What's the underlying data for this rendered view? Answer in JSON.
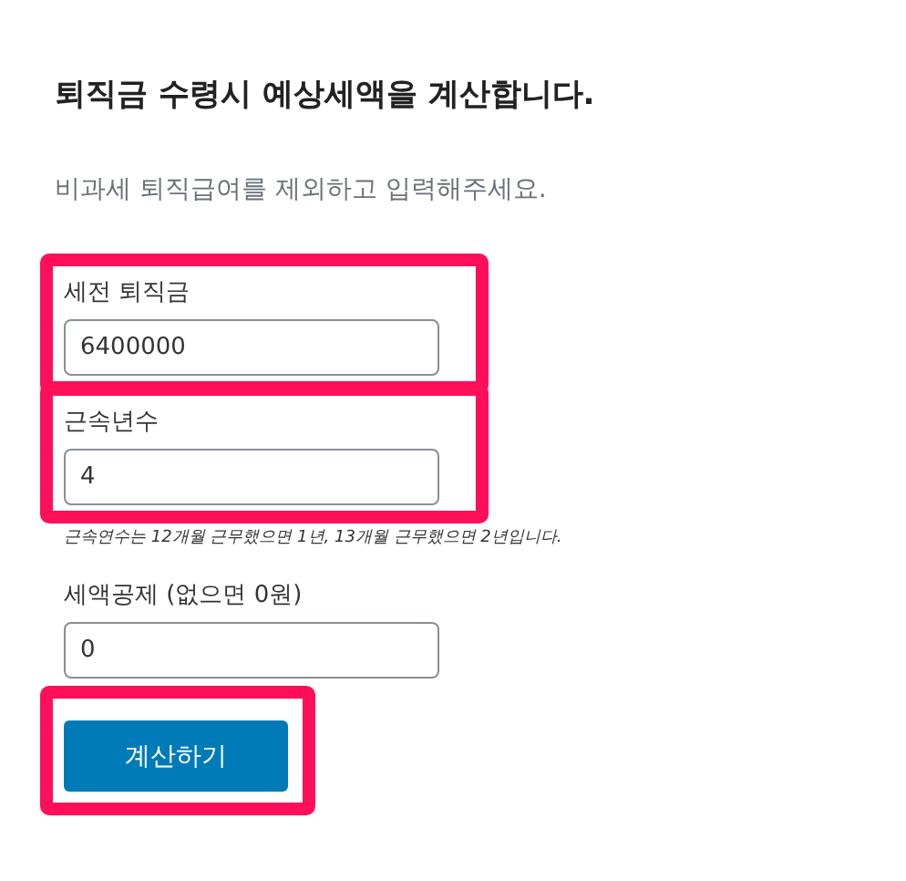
{
  "title": "퇴직금 수령시 예상세액을 계산합니다.",
  "subtitle": "비과세 퇴직급여를 제외하고 입력해주세요.",
  "fields": [
    {
      "label": "세전 퇴직금",
      "value": "6400000",
      "highlighted": true
    },
    {
      "label": "근속년수",
      "value": "4",
      "highlighted": true,
      "hint": "근속연수는 12개월 근무했으면 1년, 13개월 근무했으면 2년입니다."
    },
    {
      "label": "세액공제 (없으면 0원)",
      "value": "0",
      "highlighted": false
    }
  ],
  "button": {
    "label": "계산하기",
    "highlighted": true
  }
}
